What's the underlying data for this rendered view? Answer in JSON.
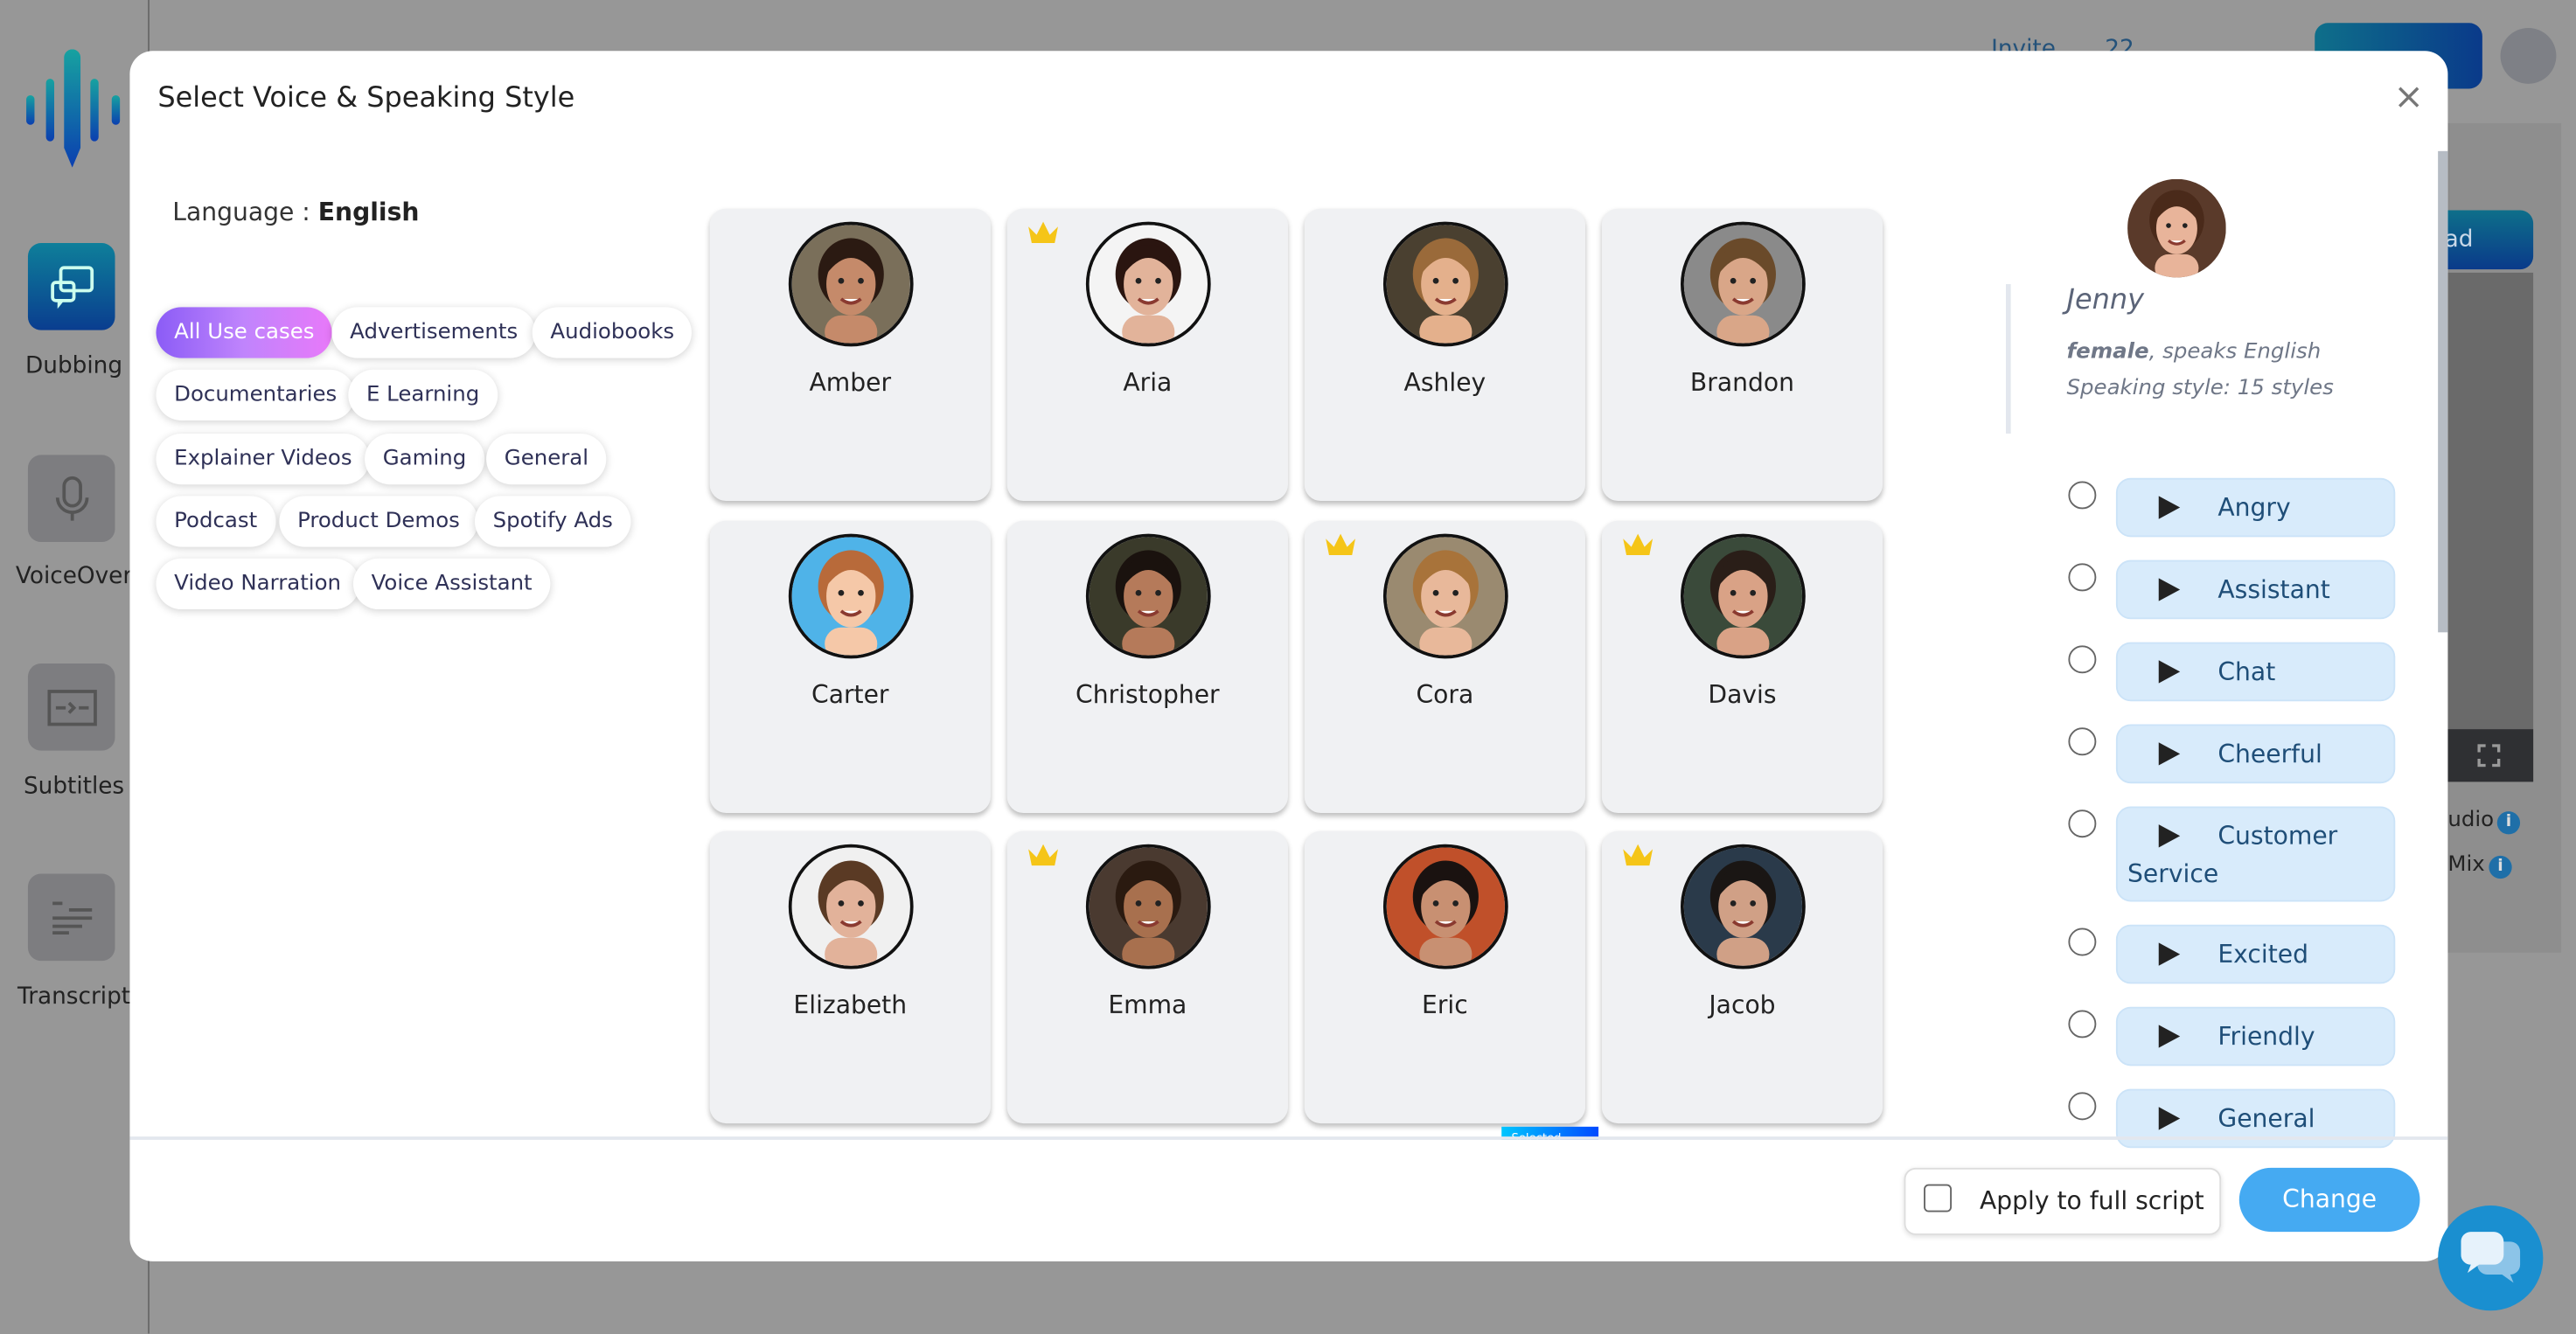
{
  "background": {
    "sidebar": [
      {
        "label": "Dubbing",
        "icon": "dubbing-icon",
        "active": true
      },
      {
        "label": "VoiceOver",
        "icon": "microphone-icon",
        "active": false
      },
      {
        "label": "Subtitles",
        "icon": "subtitles-icon",
        "active": false
      },
      {
        "label": "Transcript",
        "icon": "transcript-icon",
        "active": false
      }
    ],
    "topbar": {
      "invite": "Invite",
      "credits": "22"
    },
    "download_partial": "ad",
    "notes": [
      "udio",
      "Mix"
    ]
  },
  "modal": {
    "title": "Select Voice & Speaking Style",
    "close": "×",
    "language_label": "Language : ",
    "language_value": "English",
    "use_cases": [
      "All Use cases",
      "Advertisements",
      "Audiobooks",
      "Documentaries",
      "E Learning",
      "Explainer Videos",
      "Gaming",
      "General",
      "Podcast",
      "Product Demos",
      "Spotify Ads",
      "Video Narration",
      "Voice Assistant"
    ],
    "active_use_case": "All Use cases",
    "voices": [
      {
        "name": "Amber",
        "premium": false,
        "skin": "#c58a6a",
        "hair": "#2b1a12",
        "bg": "#7a6f5a"
      },
      {
        "name": "Aria",
        "premium": true,
        "skin": "#e2b39a",
        "hair": "#2a1510",
        "bg": "#f4f4f4"
      },
      {
        "name": "Ashley",
        "premium": false,
        "skin": "#e4b08c",
        "hair": "#9a6a3a",
        "bg": "#4a4030"
      },
      {
        "name": "Brandon",
        "premium": false,
        "skin": "#d9a688",
        "hair": "#6a4a2a",
        "bg": "#8a8a8a"
      },
      {
        "name": "Carter",
        "premium": false,
        "skin": "#f5c8a8",
        "hair": "#b86a3a",
        "bg": "#4fb3e8"
      },
      {
        "name": "Christopher",
        "premium": false,
        "skin": "#b57a5a",
        "hair": "#1a120e",
        "bg": "#3a3a2a"
      },
      {
        "name": "Cora",
        "premium": true,
        "skin": "#e8b89a",
        "hair": "#a8733a",
        "bg": "#9a8a70"
      },
      {
        "name": "Davis",
        "premium": true,
        "skin": "#d9a286",
        "hair": "#2a1e18",
        "bg": "#3a4a3a"
      },
      {
        "name": "Elizabeth",
        "premium": false,
        "skin": "#e2b29a",
        "hair": "#5a3a24",
        "bg": "#f0f0f0"
      },
      {
        "name": "Emma",
        "premium": true,
        "skin": "#a8704e",
        "hair": "#2a1a10",
        "bg": "#4a3a30"
      },
      {
        "name": "Eric",
        "premium": false,
        "skin": "#c89072",
        "hair": "#1a1210",
        "bg": "#c0502a"
      },
      {
        "name": "Jacob",
        "premium": true,
        "skin": "#d0a086",
        "hair": "#1a1614",
        "bg": "#2a3a4a"
      }
    ],
    "selected_tag": "Selected",
    "selected_voice": {
      "name": "Jenny",
      "gender": "female",
      "speaks": ", speaks English",
      "styles_text": "Speaking style: 15 styles",
      "skin": "#e8b49a",
      "hair": "#4a2a1a"
    },
    "styles": [
      "Angry",
      "Assistant",
      "Chat",
      "Cheerful",
      "Customer Service",
      "Excited",
      "Friendly",
      "General"
    ],
    "apply_label": "Apply to full script",
    "apply_checked": false,
    "change_label": "Change"
  },
  "colors": {
    "accent": "#45aaf2",
    "style_bg": "#d8ebfb",
    "crown": "#f5c518",
    "chat": "#1a8fd0"
  }
}
